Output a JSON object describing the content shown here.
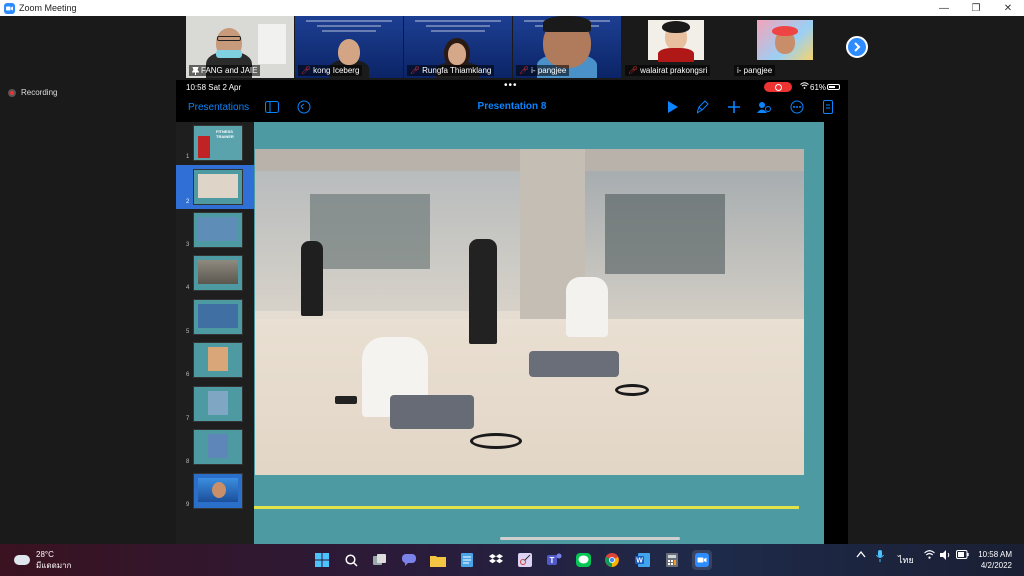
{
  "window": {
    "title": "Zoom Meeting",
    "minimize": "—",
    "maximize": "❐",
    "close": "✕"
  },
  "participants": [
    {
      "name": "FANG and JAIE",
      "muted": false
    },
    {
      "name": "kong Iceberg",
      "muted": true
    },
    {
      "name": "Rungfa Thiamklang",
      "muted": true
    },
    {
      "name": "i- pangjee",
      "muted": true
    },
    {
      "name": "walairat prakongsri",
      "muted": true
    },
    {
      "name": "i- pangjee",
      "muted": false
    }
  ],
  "recording": {
    "label": "Recording"
  },
  "ipad": {
    "status": {
      "time": "10:58  Sat 2 Apr",
      "dots": "•••",
      "battery": "61%"
    },
    "toolbar": {
      "presentations": "Presentations",
      "title": "Presentation 8"
    },
    "slides": [
      "1",
      "2",
      "3",
      "4",
      "5",
      "6",
      "7",
      "8",
      "9"
    ],
    "active_slide": 2,
    "thumb1_caption": "FITNESS TRAINER"
  },
  "taskbar": {
    "weather_temp": "28°C",
    "weather_desc": "มีแดดมาก",
    "language": "ไทย",
    "time": "10:58 AM",
    "date": "4/2/2022"
  },
  "colors": {
    "zoom_blue": "#2d8cff",
    "keynote_blue": "#0a84ff",
    "slide_teal": "#4e9aa3",
    "accent_yellow": "#e2e34a"
  }
}
